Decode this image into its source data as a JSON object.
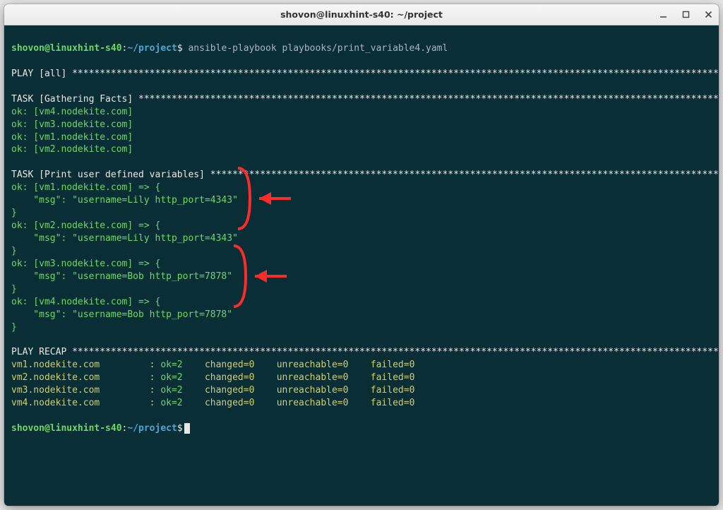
{
  "window": {
    "title": "shovon@linuxhint-s40: ~/project"
  },
  "prompt": {
    "user": "shovon@linuxhint-s40",
    "sep": ":",
    "path": "~/project",
    "dollar": "$"
  },
  "command": "ansible-playbook playbooks/print_variable4.yaml",
  "play": {
    "label": "PLAY [all]",
    "stars": "****************************************************************************************************************************"
  },
  "task_gather": {
    "label": "TASK [Gathering Facts]",
    "stars": "****************************************************************************************************************",
    "results": [
      "ok: [vm4.nodekite.com]",
      "ok: [vm3.nodekite.com]",
      "ok: [vm1.nodekite.com]",
      "ok: [vm2.nodekite.com]"
    ]
  },
  "task_print": {
    "label": "TASK [Print user defined variables]",
    "stars": "***************************************************************************************************",
    "results": [
      {
        "head": "ok: [vm1.nodekite.com] => {",
        "msg": "    \"msg\": \"username=Lily http_port=4343\"",
        "close": "}"
      },
      {
        "head": "ok: [vm2.nodekite.com] => {",
        "msg": "    \"msg\": \"username=Lily http_port=4343\"",
        "close": "}"
      },
      {
        "head": "ok: [vm3.nodekite.com] => {",
        "msg": "    \"msg\": \"username=Bob http_port=7878\"",
        "close": "}"
      },
      {
        "head": "ok: [vm4.nodekite.com] => {",
        "msg": "    \"msg\": \"username=Bob http_port=7878\"",
        "close": "}"
      }
    ]
  },
  "recap": {
    "label": "PLAY RECAP",
    "stars": "****************************************************************************************************************************",
    "rows": [
      {
        "host": "vm1.nodekite.com",
        "ok": "ok=2",
        "changed": "changed=0",
        "unreachable": "unreachable=0",
        "failed": "failed=0"
      },
      {
        "host": "vm2.nodekite.com",
        "ok": "ok=2",
        "changed": "changed=0",
        "unreachable": "unreachable=0",
        "failed": "failed=0"
      },
      {
        "host": "vm3.nodekite.com",
        "ok": "ok=2",
        "changed": "changed=0",
        "unreachable": "unreachable=0",
        "failed": "failed=0"
      },
      {
        "host": "vm4.nodekite.com",
        "ok": "ok=2",
        "changed": "changed=0",
        "unreachable": "unreachable=0",
        "failed": "failed=0"
      }
    ]
  },
  "icons": {
    "minimize": "minimize-icon",
    "maximize": "maximize-icon",
    "close": "close-icon"
  }
}
